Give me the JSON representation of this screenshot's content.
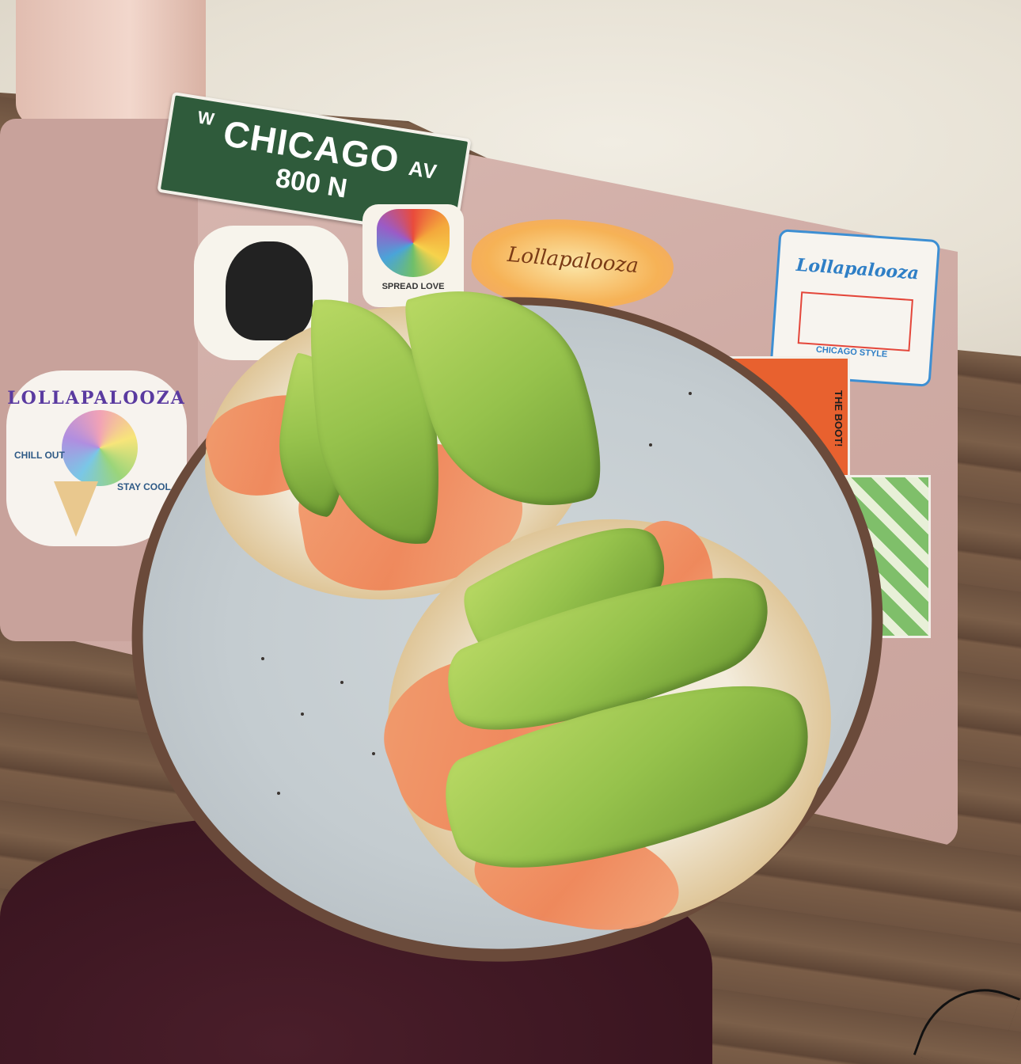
{
  "scene": {
    "street_sign": {
      "prefix": "W",
      "name": "CHICAGO",
      "suffix": "AV",
      "number": "800 N"
    },
    "stickers": {
      "torch_text": "SPREAD LOVE",
      "lollapalooza_orange": "Lollapalooza",
      "lollapalooza_box_brand": "Lollapalooza",
      "lollapalooza_box_text": "CHICAGO STYLE",
      "icecream_arc": "LOLLAPALOOZA",
      "icecream_left": "CHILL OUT",
      "icecream_right": "STAY COOL",
      "boot_text": "THE BOOT!"
    }
  }
}
